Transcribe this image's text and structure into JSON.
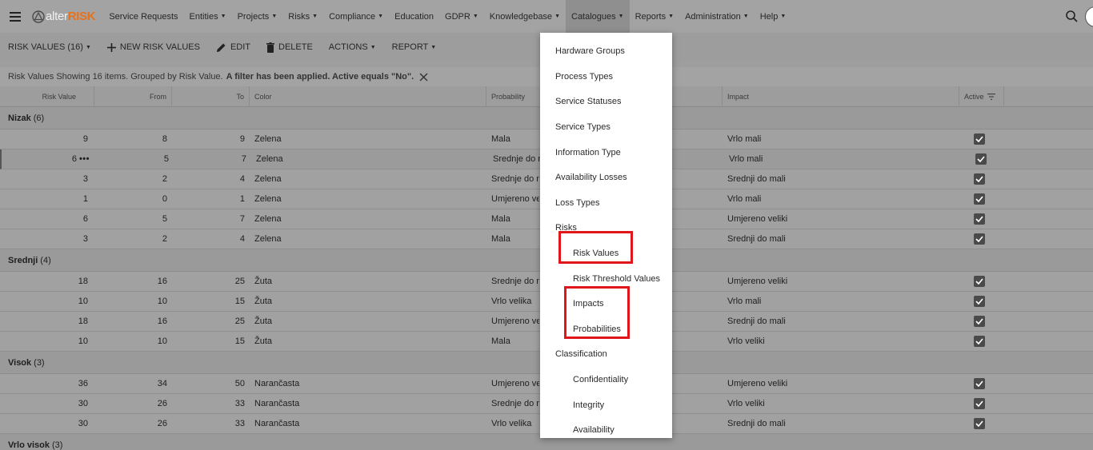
{
  "nav": {
    "logo_alter": "alter",
    "logo_risk": "RISK",
    "items": [
      {
        "label": "Service Requests",
        "has_caret": false
      },
      {
        "label": "Entities",
        "has_caret": true
      },
      {
        "label": "Projects",
        "has_caret": true
      },
      {
        "label": "Risks",
        "has_caret": true
      },
      {
        "label": "Compliance",
        "has_caret": true
      },
      {
        "label": "Education",
        "has_caret": false
      },
      {
        "label": "GDPR",
        "has_caret": true
      },
      {
        "label": "Knowledgebase",
        "has_caret": true
      },
      {
        "label": "Catalogues",
        "has_caret": true,
        "active": true
      },
      {
        "label": "Reports",
        "has_caret": true
      },
      {
        "label": "Administration",
        "has_caret": true
      },
      {
        "label": "Help",
        "has_caret": true
      }
    ]
  },
  "toolbar": {
    "risk_values_label": "RISK VALUES (16)",
    "new_label": "NEW RISK VALUES",
    "edit_label": "EDIT",
    "delete_label": "DELETE",
    "actions_label": "ACTIONS",
    "report_label": "REPORT"
  },
  "info": {
    "text": "Risk Values Showing 16 items. Grouped by Risk Value.",
    "filter_text": "A filter has been applied. Active equals \"No\"."
  },
  "columns": {
    "risk_value": "Risk Value",
    "from": "From",
    "to": "To",
    "color": "Color",
    "probability": "Probability",
    "impact": "Impact",
    "active": "Active"
  },
  "groups": [
    {
      "name": "Nizak",
      "count": "(6)",
      "rows": [
        {
          "rv": "9",
          "from": "8",
          "to": "9",
          "color": "Zelena",
          "prob": "Mala",
          "impact": "Vrlo mali",
          "active": true
        },
        {
          "rv": "6",
          "from": "5",
          "to": "7",
          "color": "Zelena",
          "prob": "Srednje do mali",
          "impact": "Vrlo mali",
          "active": true,
          "selected": true
        },
        {
          "rv": "3",
          "from": "2",
          "to": "4",
          "color": "Zelena",
          "prob": "Srednje do mali",
          "impact": "Srednji do mali",
          "active": true
        },
        {
          "rv": "1",
          "from": "0",
          "to": "1",
          "color": "Zelena",
          "prob": "Umjereno veliki",
          "impact": "Vrlo mali",
          "active": true
        },
        {
          "rv": "6",
          "from": "5",
          "to": "7",
          "color": "Zelena",
          "prob": "Mala",
          "impact": "Umjereno veliki",
          "active": true
        },
        {
          "rv": "3",
          "from": "2",
          "to": "4",
          "color": "Zelena",
          "prob": "Mala",
          "impact": "Srednji do mali",
          "active": true
        }
      ]
    },
    {
      "name": "Srednji",
      "count": "(4)",
      "rows": [
        {
          "rv": "18",
          "from": "16",
          "to": "25",
          "color": "Žuta",
          "prob": "Srednje do mali",
          "impact": "Umjereno veliki",
          "active": true
        },
        {
          "rv": "10",
          "from": "10",
          "to": "15",
          "color": "Žuta",
          "prob": "Vrlo velika",
          "impact": "Vrlo mali",
          "active": true
        },
        {
          "rv": "18",
          "from": "16",
          "to": "25",
          "color": "Žuta",
          "prob": "Umjereno veliki",
          "impact": "Srednji do mali",
          "active": true
        },
        {
          "rv": "10",
          "from": "10",
          "to": "15",
          "color": "Žuta",
          "prob": "Mala",
          "impact": "Vrlo veliki",
          "active": true
        }
      ]
    },
    {
      "name": "Visok",
      "count": "(3)",
      "rows": [
        {
          "rv": "36",
          "from": "34",
          "to": "50",
          "color": "Narančasta",
          "prob": "Umjereno veliki",
          "impact": "Umjereno veliki",
          "active": true
        },
        {
          "rv": "30",
          "from": "26",
          "to": "33",
          "color": "Narančasta",
          "prob": "Srednje do mali",
          "impact": "Vrlo veliki",
          "active": true
        },
        {
          "rv": "30",
          "from": "26",
          "to": "33",
          "color": "Narančasta",
          "prob": "Vrlo velika",
          "impact": "Srednji do mali",
          "active": true
        }
      ]
    },
    {
      "name": "Vrlo visok",
      "count": "(3)",
      "rows": []
    }
  ],
  "menu": {
    "items": [
      {
        "label": "Hardware Groups",
        "level": "top"
      },
      {
        "label": "Process Types",
        "level": "top"
      },
      {
        "label": "Service Statuses",
        "level": "top"
      },
      {
        "label": "Service Types",
        "level": "top"
      },
      {
        "label": "Information Type",
        "level": "top"
      },
      {
        "label": "Availability Losses",
        "level": "top"
      },
      {
        "label": "Loss Types",
        "level": "top"
      },
      {
        "label": "Risks",
        "level": "top"
      },
      {
        "label": "Risk Values",
        "level": "sub"
      },
      {
        "label": "Risk Threshold Values",
        "level": "sub"
      },
      {
        "label": "Impacts",
        "level": "sub"
      },
      {
        "label": "Probabilities",
        "level": "sub"
      },
      {
        "label": "Classification",
        "level": "top"
      },
      {
        "label": "Confidentiality",
        "level": "sub"
      },
      {
        "label": "Integrity",
        "level": "sub"
      },
      {
        "label": "Availability",
        "level": "sub"
      }
    ]
  },
  "colors": {
    "brand_orange": "#e8711c",
    "highlight_red": "#e0161b"
  },
  "icons": [
    "menu-icon",
    "logo-icon",
    "search-icon",
    "plus-icon",
    "pencil-icon",
    "trash-icon",
    "close-icon",
    "filter-icon",
    "checkbox-checked-icon",
    "more-icon"
  ]
}
